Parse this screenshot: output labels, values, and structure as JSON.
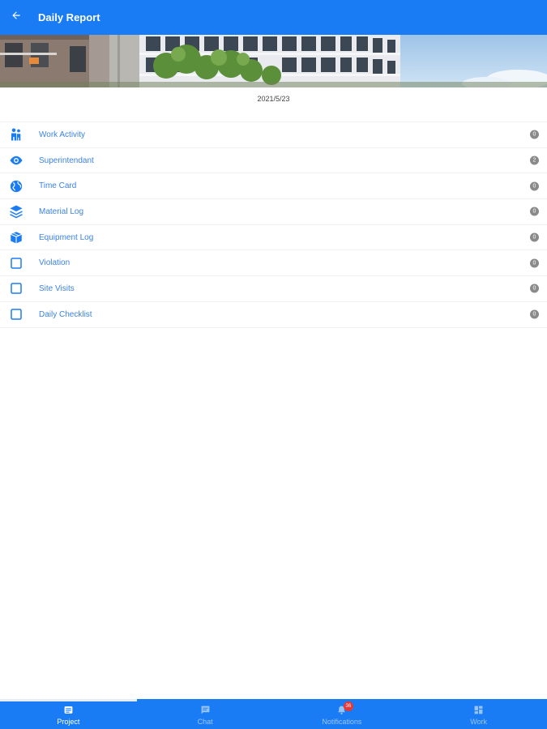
{
  "header": {
    "title": "Daily Report",
    "back_icon": "arrow-left-icon"
  },
  "report": {
    "date": "2021/5/23"
  },
  "items": [
    {
      "label": "Work Activity",
      "icon": "workers-icon",
      "count": "0"
    },
    {
      "label": "Superintendant",
      "icon": "eye-icon",
      "count": "2"
    },
    {
      "label": "Time Card",
      "icon": "globe-icon",
      "count": "0"
    },
    {
      "label": "Material Log",
      "icon": "layers-icon",
      "count": "0"
    },
    {
      "label": "Equipment Log",
      "icon": "box-icon",
      "count": "0"
    },
    {
      "label": "Violation",
      "icon": "checkbox-icon",
      "count": "0"
    },
    {
      "label": "Site Visits",
      "icon": "checkbox-icon",
      "count": "0"
    },
    {
      "label": "Daily Checklist",
      "icon": "checkbox-icon",
      "count": "0"
    }
  ],
  "tabs": [
    {
      "label": "Project",
      "icon": "list-icon",
      "active": true
    },
    {
      "label": "Chat",
      "icon": "chat-icon",
      "active": false
    },
    {
      "label": "Notifications",
      "icon": "bell-icon",
      "active": false,
      "badge": "36"
    },
    {
      "label": "Work",
      "icon": "dashboard-icon",
      "active": false
    }
  ],
  "colors": {
    "primary": "#1a7cf5",
    "link": "#3b82e6",
    "count_badge": "#8a8a8a",
    "notification_badge": "#e53935"
  }
}
